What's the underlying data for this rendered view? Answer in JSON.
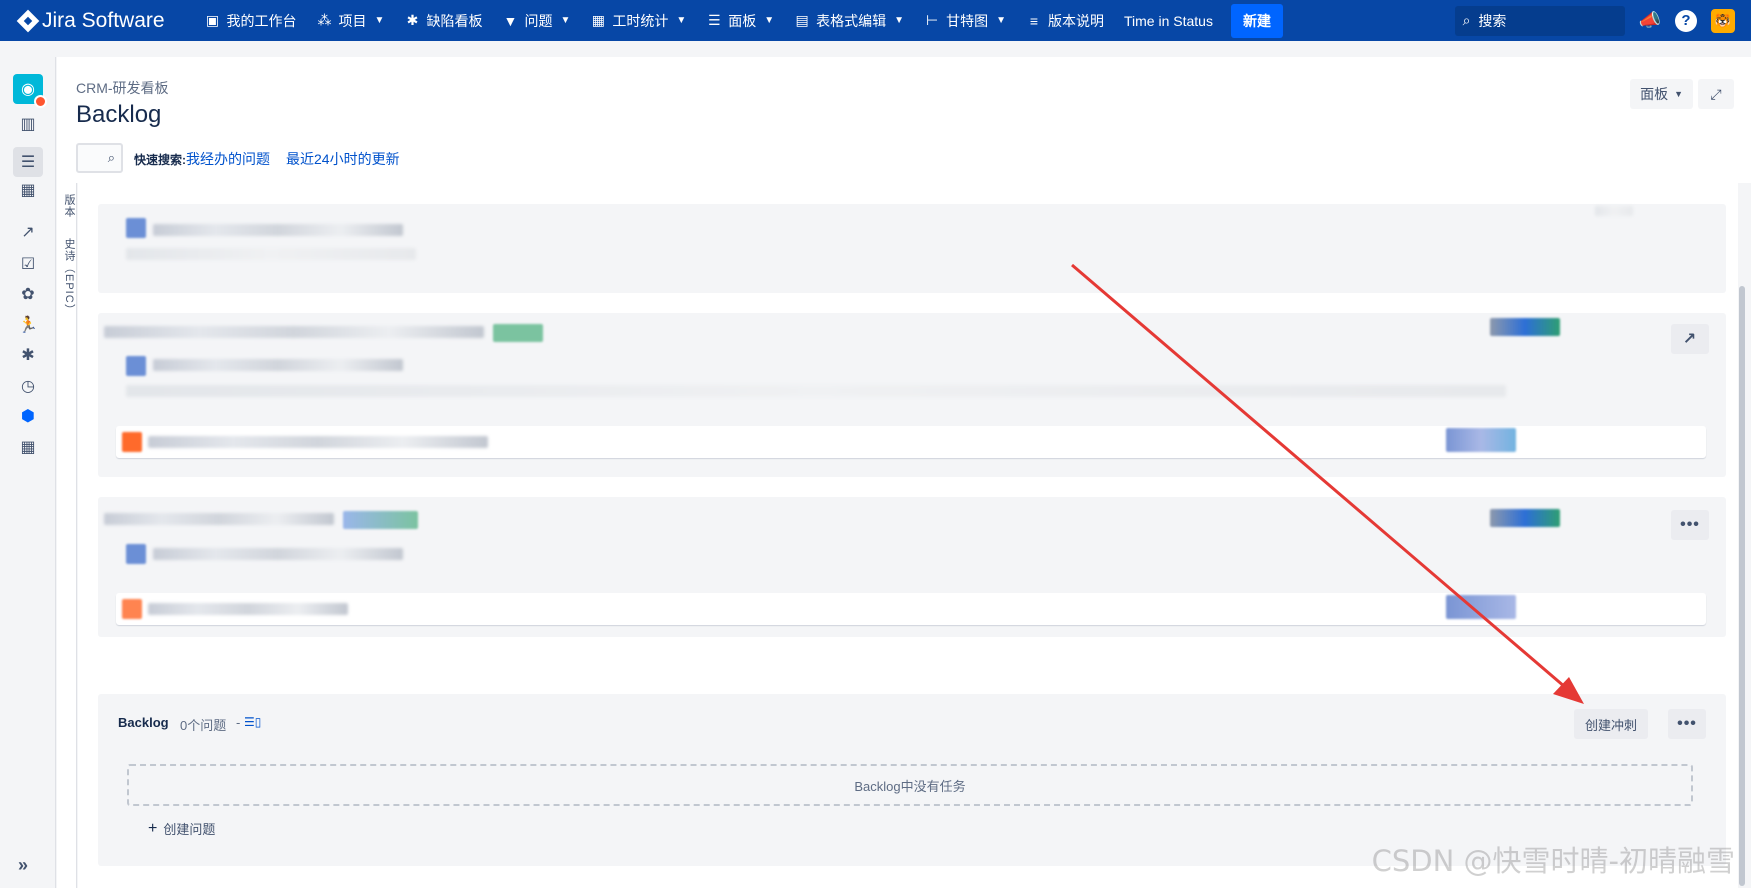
{
  "nav": {
    "logo_text": "Jira Software",
    "items": [
      {
        "label": "我的工作台",
        "icon": "clipboard-icon",
        "glyph": "▣",
        "chevron": false
      },
      {
        "label": "项目",
        "icon": "project-icon",
        "glyph": "⁂",
        "chevron": true
      },
      {
        "label": "缺陷看板",
        "icon": "bug-icon",
        "glyph": "✱",
        "chevron": false
      },
      {
        "label": "问题",
        "icon": "filter-icon",
        "glyph": "▼",
        "chevron": true
      },
      {
        "label": "工时统计",
        "icon": "calendar-icon",
        "glyph": "▦",
        "chevron": true
      },
      {
        "label": "面板",
        "icon": "dashboard-icon",
        "glyph": "☰",
        "chevron": true
      },
      {
        "label": "表格式编辑",
        "icon": "table-icon",
        "glyph": "▤",
        "chevron": true
      },
      {
        "label": "甘特图",
        "icon": "gantt-icon",
        "glyph": "⊢",
        "chevron": true
      },
      {
        "label": "版本说明",
        "icon": "release-notes-icon",
        "glyph": "≡",
        "chevron": false
      },
      {
        "label": "Time in Status",
        "icon": "",
        "glyph": "",
        "chevron": false
      }
    ],
    "new_button": "新建",
    "search_placeholder": "搜索"
  },
  "sidebar": {
    "items": [
      {
        "icon": "backlog-board-icon",
        "glyph": "▥"
      },
      {
        "icon": "backlog-icon",
        "glyph": "☰",
        "active": true
      },
      {
        "icon": "board-icon",
        "glyph": "▦"
      },
      {
        "icon": "reports-icon",
        "glyph": "↗"
      },
      {
        "icon": "issues-icon",
        "glyph": "☑"
      },
      {
        "icon": "components-icon",
        "glyph": "✿"
      },
      {
        "icon": "sprint-runner-icon",
        "glyph": "🏃"
      },
      {
        "icon": "bug-icon",
        "glyph": "✱"
      },
      {
        "icon": "release-icon",
        "glyph": "◷"
      },
      {
        "icon": "app-hex-icon",
        "glyph": "⬢",
        "blue": true
      },
      {
        "icon": "table-icon",
        "glyph": "▦"
      }
    ]
  },
  "vertical_tabs": [
    "版本",
    "史诗（EPIC）"
  ],
  "header": {
    "breadcrumb": "CRM-研发看板",
    "title": "Backlog",
    "quick_search_label": "快速搜索:",
    "quick_filters": [
      "我经办的问题",
      "最近24小时的更新"
    ],
    "board_button": "面板"
  },
  "backlog": {
    "title": "Backlog",
    "count": "0个问题",
    "create_sprint": "创建冲刺",
    "empty_message": "Backlog中没有任务",
    "create_issue": "创建问题"
  },
  "watermark": "CSDN @快雪时晴-初晴融雪",
  "colors": {
    "nav_bg": "#0747a6",
    "new_button": "#0065ff",
    "link": "#0052cc",
    "annotation_arrow": "#e53935"
  }
}
